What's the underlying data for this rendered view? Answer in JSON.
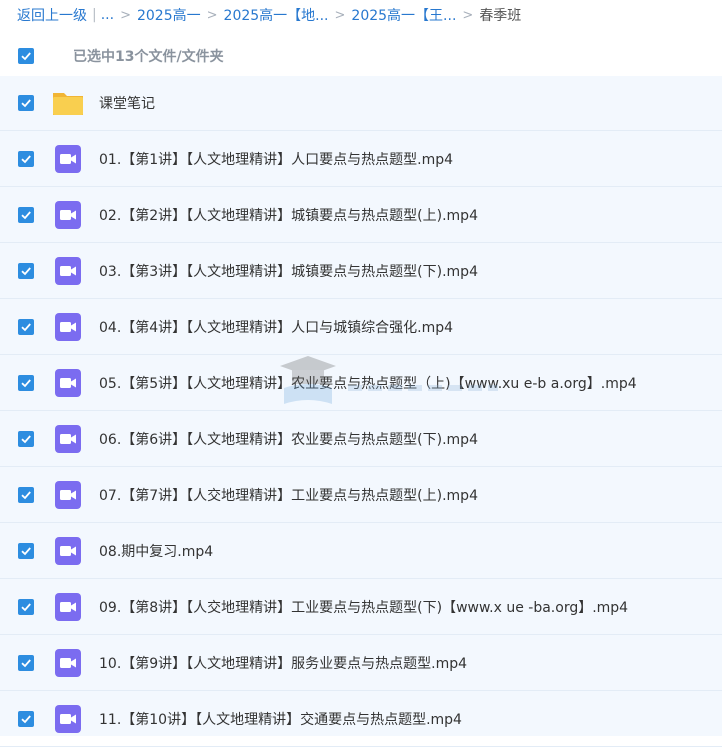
{
  "breadcrumb": {
    "back": "返回上一级",
    "ellipsis": "...",
    "items": [
      "2025高一",
      "2025高一【地...",
      "2025高一【王..."
    ],
    "current": "春季班"
  },
  "selection": {
    "text": "已选中13个文件/文件夹"
  },
  "files": [
    {
      "name": "课堂笔记",
      "icon": "folder-icon"
    },
    {
      "name": "01.【第1讲】【人文地理精讲】人口要点与热点题型.mp4",
      "icon": "video-icon"
    },
    {
      "name": "02.【第2讲】【人文地理精讲】城镇要点与热点题型(上).mp4",
      "icon": "video-icon"
    },
    {
      "name": "03.【第3讲】【人文地理精讲】城镇要点与热点题型(下).mp4",
      "icon": "video-icon"
    },
    {
      "name": "04.【第4讲】【人文地理精讲】人口与城镇综合强化.mp4",
      "icon": "video-icon"
    },
    {
      "name": "05.【第5讲】【人文地理精讲】农业要点与热点题型（上)【www.xu e-b a.org】.mp4",
      "icon": "video-icon"
    },
    {
      "name": "06.【第6讲】【人文地理精讲】农业要点与热点题型(下).mp4",
      "icon": "video-icon"
    },
    {
      "name": "07.【第7讲】【人交地理精讲】工业要点与热点题型(上).mp4",
      "icon": "video-icon"
    },
    {
      "name": "08.期中复习.mp4",
      "icon": "video-icon"
    },
    {
      "name": "09.【第8讲】【人交地理精讲】工业要点与热点题型(下)【www.x ue -ba.org】.mp4",
      "icon": "video-icon"
    },
    {
      "name": "10.【第9讲】【人文地理精讲】服务业要点与热点题型.mp4",
      "icon": "video-icon"
    },
    {
      "name": "11.【第10讲】【人文地理精讲】交通要点与热点题型.mp4",
      "icon": "video-icon"
    }
  ],
  "colors": {
    "accent": "#2d8de0",
    "link": "#2878cf",
    "folder": "#f9c94a",
    "video": "#7b6cf0",
    "list_bg": "#f3f8fe"
  }
}
